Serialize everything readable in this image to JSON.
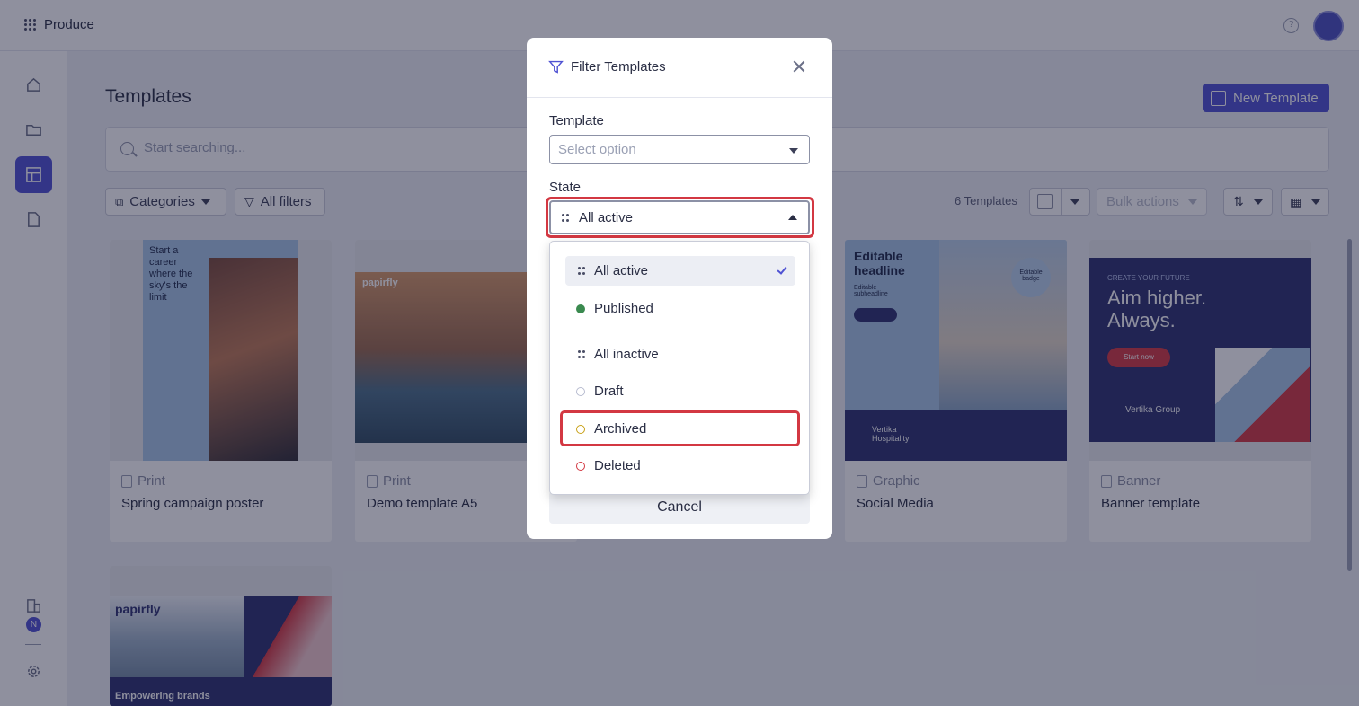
{
  "app": {
    "name": "Produce"
  },
  "page": {
    "title": "Templates",
    "new_button": "New Template"
  },
  "search": {
    "placeholder": "Start searching..."
  },
  "toolbar": {
    "categories": "Categories",
    "all_filters": "All filters",
    "count": "6 Templates",
    "bulk_actions": "Bulk actions"
  },
  "sidebar": {
    "badge": "N"
  },
  "cards": [
    {
      "type": "Print",
      "name": "Spring campaign poster",
      "thumb_text": "Start a career where the sky's the limit"
    },
    {
      "type": "Print",
      "name": "Demo template A5",
      "thumb_text": "papirfly"
    },
    {
      "type": "Graphic",
      "name": "Social Media",
      "thumb_text": "Editable headline",
      "thumb_sub": "Editable subheadline",
      "badge": "Editable badge",
      "brand": "Vertika Hospitality"
    },
    {
      "type": "Banner",
      "name": "Banner template",
      "thumb_eyebrow": "CREATE YOUR FUTURE",
      "thumb_text": "Aim higher. Always.",
      "cta": "Start now",
      "brand": "Vertika Group"
    },
    {
      "type": "",
      "name": "",
      "thumb_text": "Empowering brands",
      "brand": "papirfly"
    }
  ],
  "modal": {
    "title": "Filter Templates",
    "template_label": "Template",
    "template_placeholder": "Select option",
    "state_label": "State",
    "state_value": "All active",
    "cancel": "Cancel",
    "options": [
      {
        "label": "All active",
        "icon": "grid-dots-icon",
        "selected": true
      },
      {
        "label": "Published",
        "icon": "dot",
        "color": "#3a8a4f"
      },
      {
        "label": "All inactive",
        "icon": "grid-dots-icon"
      },
      {
        "label": "Draft",
        "icon": "ring",
        "color": "#b8bcd0"
      },
      {
        "label": "Archived",
        "icon": "ring",
        "color": "#c9a21a"
      },
      {
        "label": "Deleted",
        "icon": "ring",
        "color": "#d33842"
      }
    ]
  }
}
